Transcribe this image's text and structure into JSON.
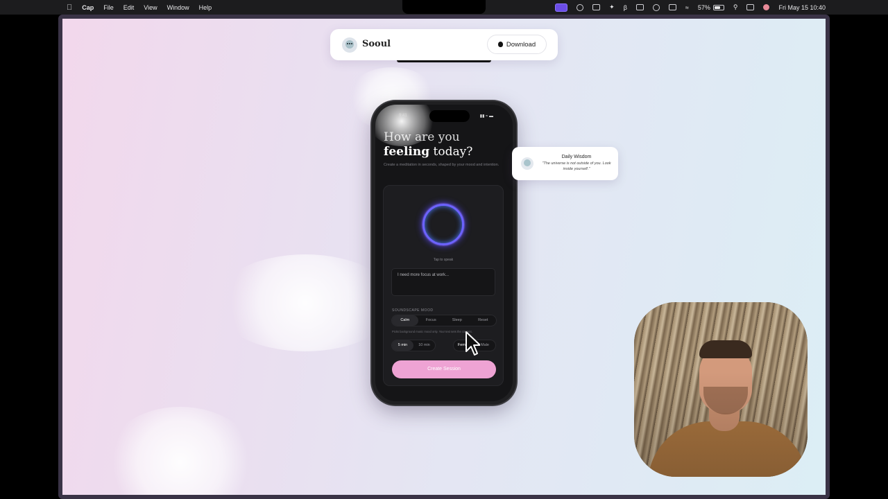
{
  "menubar": {
    "app_name": "Cap",
    "menus": [
      "File",
      "Edit",
      "View",
      "Window",
      "Help"
    ],
    "battery": "57%",
    "clock": "Fri May 15  10:40"
  },
  "nav": {
    "brand": "Sooul",
    "download_label": "Download"
  },
  "phone": {
    "status_time": "9:41",
    "headline_line1": "How are you",
    "headline_bold": "feeling",
    "headline_rest": " today?",
    "subline": "Create a meditation in seconds, shaped by your mood and intention.",
    "tap_label": "Tap to speak",
    "input_placeholder": "I need more focus at work...",
    "soundscape_label": "SOUNDSCAPE MOOD",
    "moods": [
      "Calm",
      "Focus",
      "Sleep",
      "Reset"
    ],
    "selected_mood": "Calm",
    "mood_note": "Picks background music mood only. Your text sets the content.",
    "durations": [
      "5 min",
      "10 min"
    ],
    "selected_duration": "5 min",
    "voices": [
      "Female",
      "Male"
    ],
    "create_label": "Create Session"
  },
  "wisdom": {
    "title": "Daily Wisdom",
    "quote": "\"The universe is not outside of you. Look inside yourself.\""
  },
  "colors": {
    "accent_pink": "#eea3d4",
    "orb_purple": "#6c63ff"
  }
}
